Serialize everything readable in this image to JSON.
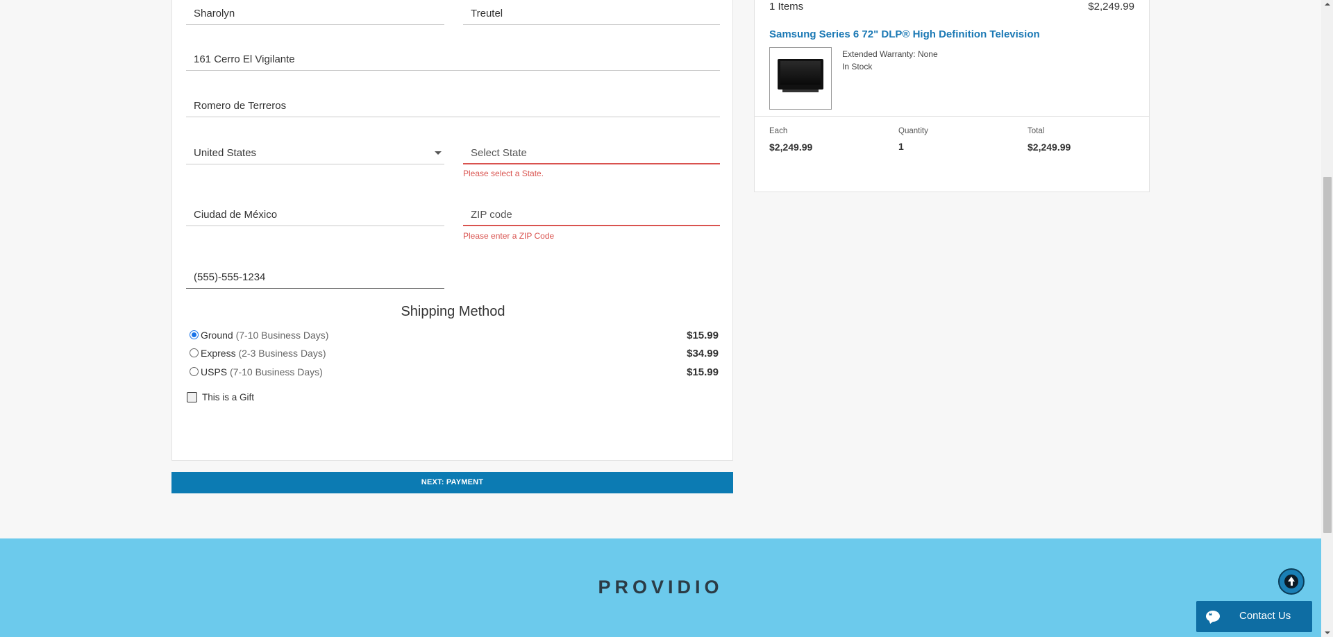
{
  "form": {
    "first_name": "Sharolyn",
    "last_name": "Treutel",
    "address1": "161 Cerro El Vigilante",
    "address2": "Romero de Terreros",
    "country": "United States",
    "state_placeholder": "Select State",
    "state_error": "Please select a State.",
    "city": "Ciudad de México",
    "zip_placeholder": "ZIP code",
    "zip_error": "Please enter a ZIP Code",
    "phone": "(555)-555-1234"
  },
  "shipping": {
    "title": "Shipping Method",
    "options": [
      {
        "name": "Ground",
        "days": "(7-10 Business Days)",
        "price": "$15.99",
        "selected": true
      },
      {
        "name": "Express",
        "days": "(2-3 Business Days)",
        "price": "$34.99",
        "selected": false
      },
      {
        "name": "USPS",
        "days": "(7-10 Business Days)",
        "price": "$15.99",
        "selected": false
      }
    ],
    "gift_label": "This is a Gift",
    "next_button": "NEXT: PAYMENT"
  },
  "summary": {
    "items_count": "1 Items",
    "items_total": "$2,249.99",
    "product_name": "Samsung Series 6 72\" DLP® High Definition Television",
    "warranty": "Extended Warranty: None",
    "stock": "In Stock",
    "each_label": "Each",
    "each_value": "$2,249.99",
    "qty_label": "Quantity",
    "qty_value": "1",
    "total_label": "Total",
    "total_value": "$2,249.99"
  },
  "footer": {
    "brand": "PROVIDIO",
    "contact_label": "Contact Us"
  },
  "colors": {
    "accent": "#0c7bb3",
    "error": "#d9534f",
    "footer_bg": "#6ccaec",
    "link": "#1a78b4"
  }
}
